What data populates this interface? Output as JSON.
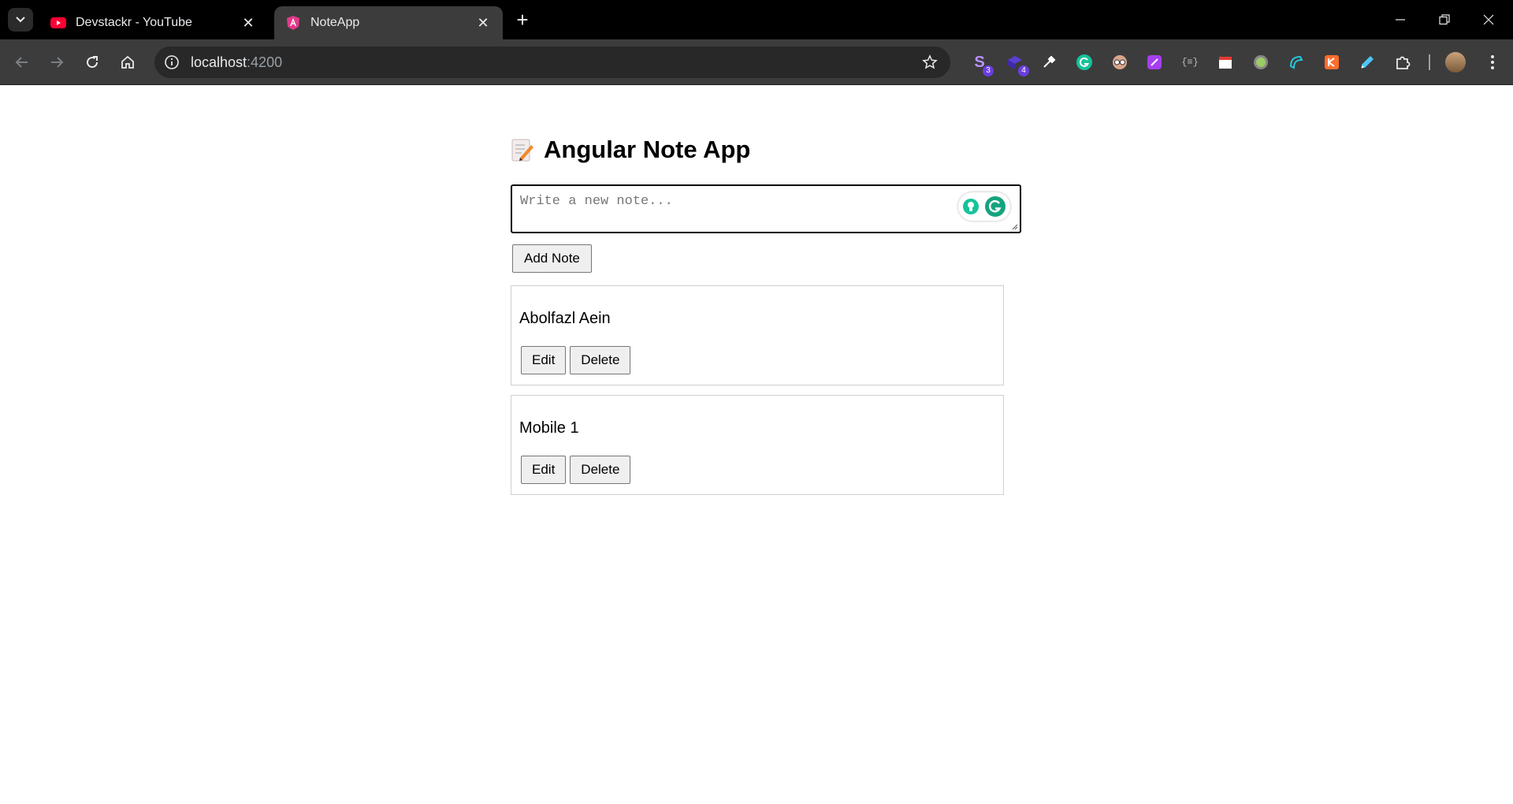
{
  "browser": {
    "tabs": [
      {
        "title": "Devstackr - YouTube",
        "favicon": "youtube-icon",
        "active": false
      },
      {
        "title": "NoteApp",
        "favicon": "angular-icon",
        "active": true
      }
    ],
    "address": {
      "host": "localhost",
      "port": ":4200"
    },
    "extensions": [
      {
        "name": "s-extension-icon",
        "badge": "3"
      },
      {
        "name": "cube-extension-icon",
        "badge": "4"
      },
      {
        "name": "color-picker-icon"
      },
      {
        "name": "grammarly-extension-icon"
      },
      {
        "name": "spy-extension-icon"
      },
      {
        "name": "purple-extension-icon"
      },
      {
        "name": "json-extension-icon"
      },
      {
        "name": "calendar-extension-icon"
      },
      {
        "name": "circle-extension-icon"
      },
      {
        "name": "teal-extension-icon"
      },
      {
        "name": "orange-extension-icon"
      },
      {
        "name": "highlighter-extension-icon"
      },
      {
        "name": "puzzle-extensions-icon"
      }
    ]
  },
  "app": {
    "title": "Angular Note App",
    "title_icon": "memo-icon",
    "input_placeholder": "Write a new note...",
    "add_button": "Add Note",
    "notes": [
      {
        "text": "Abolfazl Aein",
        "edit_label": "Edit",
        "delete_label": "Delete"
      },
      {
        "text": "Mobile 1",
        "edit_label": "Edit",
        "delete_label": "Delete"
      }
    ]
  },
  "colors": {
    "chrome_bg": "#000000",
    "toolbar_bg": "#3c3c3c",
    "omnibox_bg": "#282828",
    "grammarly": "#15c39a"
  }
}
